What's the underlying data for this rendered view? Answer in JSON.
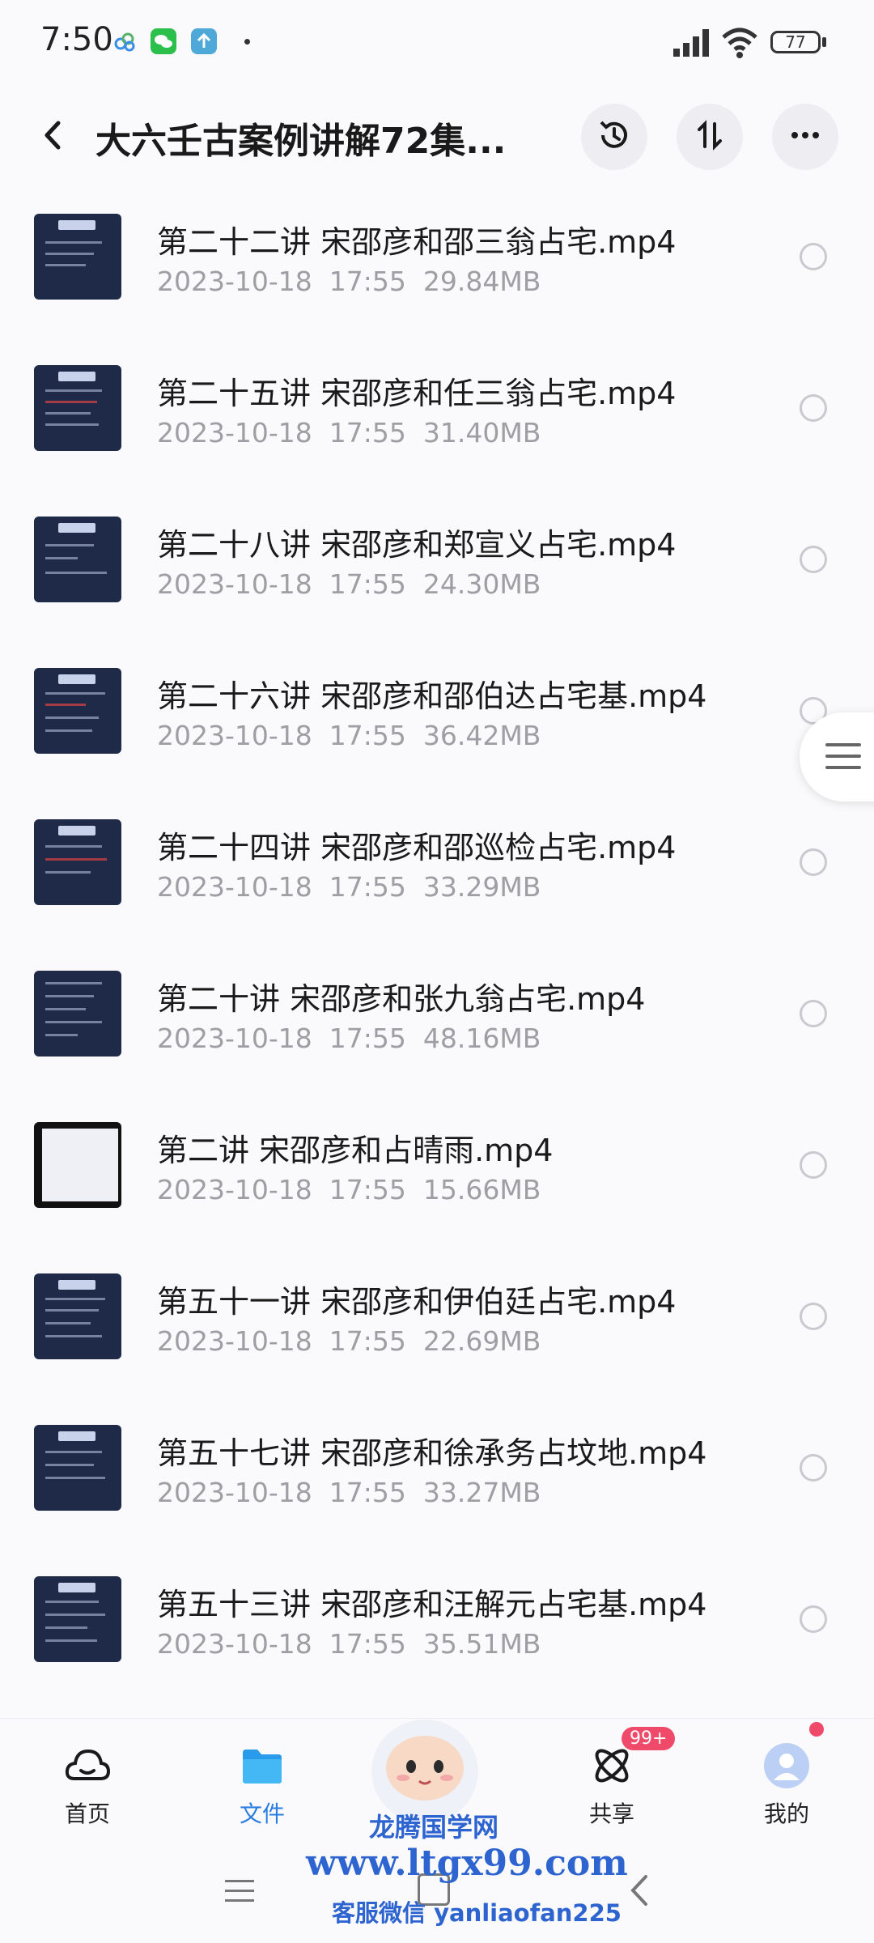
{
  "status_bar": {
    "time": "7:50",
    "battery": "77",
    "icons": [
      "cloud-app-icon",
      "wechat-icon",
      "upload-app-icon",
      "signal-icon",
      "wifi-icon",
      "battery-icon"
    ]
  },
  "header": {
    "title": "大六壬古案例讲解72集...",
    "actions": [
      "history-icon",
      "sort-icon",
      "more-icon"
    ]
  },
  "files": [
    {
      "name": "第二十二讲 宋邵彦和邵三翁占宅.mp4",
      "date": "2023-10-18",
      "time": "17:55",
      "size": "29.84MB"
    },
    {
      "name": "第二十五讲 宋邵彦和任三翁占宅.mp4",
      "date": "2023-10-18",
      "time": "17:55",
      "size": "31.40MB"
    },
    {
      "name": "第二十八讲 宋邵彦和郑宣义占宅.mp4",
      "date": "2023-10-18",
      "time": "17:55",
      "size": "24.30MB"
    },
    {
      "name": "第二十六讲 宋邵彦和邵伯达占宅基.mp4",
      "date": "2023-10-18",
      "time": "17:55",
      "size": "36.42MB"
    },
    {
      "name": "第二十四讲 宋邵彦和邵巡检占宅.mp4",
      "date": "2023-10-18",
      "time": "17:55",
      "size": "33.29MB"
    },
    {
      "name": "第二十讲 宋邵彦和张九翁占宅.mp4",
      "date": "2023-10-18",
      "time": "17:55",
      "size": "48.16MB"
    },
    {
      "name": "第二讲 宋邵彦和占晴雨.mp4",
      "date": "2023-10-18",
      "time": "17:55",
      "size": "15.66MB"
    },
    {
      "name": "第五十一讲 宋邵彦和伊伯廷占宅.mp4",
      "date": "2023-10-18",
      "time": "17:55",
      "size": "22.69MB"
    },
    {
      "name": "第五十七讲 宋邵彦和徐承务占坟地.mp4",
      "date": "2023-10-18",
      "time": "17:55",
      "size": "33.27MB"
    },
    {
      "name": "第五十三讲 宋邵彦和汪解元占宅基.mp4",
      "date": "2023-10-18",
      "time": "17:55",
      "size": "35.51MB"
    }
  ],
  "bottom_nav": {
    "home": "首页",
    "files": "文件",
    "share": "共享",
    "share_badge": "99+",
    "mine": "我的",
    "active": "files",
    "accent": "#2a7de1"
  },
  "watermark": {
    "line1": "龙腾国学网",
    "line2": "www.ltgx99.com",
    "line3": "客服微信 yanliaofan225"
  }
}
